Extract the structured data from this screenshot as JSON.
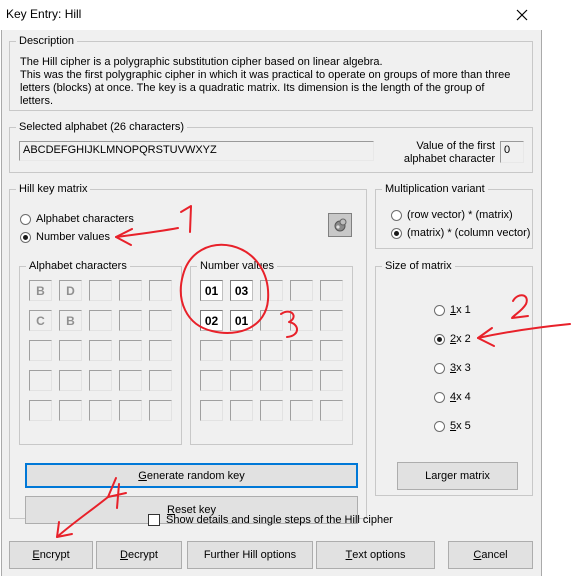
{
  "window": {
    "title": "Key Entry: Hill"
  },
  "description": {
    "legend": "Description",
    "lines": [
      "The Hill cipher is a polygraphic substitution cipher based on linear algebra.",
      "This was the first polygraphic cipher in which it was practical to operate on groups of more than three",
      "letters (blocks) at once. The key is a quadratic matrix. Its dimension is the length of the group of letters."
    ]
  },
  "alphabet": {
    "legend": "Selected alphabet (26 characters)",
    "value": "ABCDEFGHIJKLMNOPQRSTUVWXYZ",
    "first_value_label_1": "Value of the first",
    "first_value_label_2": "alphabet character",
    "first_value": "0"
  },
  "hill_key_matrix": {
    "legend": "Hill key matrix",
    "option_alphabet": "Alphabet characters",
    "option_numbers": "Number values",
    "selected": "Number values",
    "alpha_group_legend": "Alphabet characters",
    "number_group_legend": "Number values",
    "alpha_cells": [
      [
        "B",
        "D"
      ],
      [
        "C",
        "B"
      ]
    ],
    "number_cells": [
      [
        "01",
        "03"
      ],
      [
        "02",
        "01"
      ]
    ]
  },
  "multiplication": {
    "legend": "Multiplication variant",
    "option_1": "(row vector) * (matrix)",
    "option_2": "(matrix) * (column vector)",
    "selected": "(matrix) * (column vector)"
  },
  "size": {
    "legend": "Size of matrix",
    "options": [
      {
        "a": "1",
        "b": " x 1"
      },
      {
        "a": "2",
        "b": " x 2"
      },
      {
        "a": "3",
        "b": " x 3"
      },
      {
        "a": "4",
        "b": " x 4"
      },
      {
        "a": "5",
        "b": " x 5"
      }
    ],
    "selected": "2 x 2",
    "larger_button": "Larger matrix"
  },
  "buttons": {
    "generate_a": "G",
    "generate_b": "enerate random key",
    "reset_a": "R",
    "reset_b": "eset key",
    "encrypt_a": "E",
    "encrypt_b": "ncrypt",
    "decrypt_a": "D",
    "decrypt_b": "ecrypt",
    "further": "Further Hill options",
    "text_a": "T",
    "text_b": "ext options",
    "cancel_a": "C",
    "cancel_b": "ancel"
  },
  "show_details": {
    "label": "Show details and single steps of the Hill cipher",
    "checked": false
  },
  "annotations": [
    "1",
    "2",
    "3",
    "4"
  ],
  "colors": {
    "annotation": "#e8212a",
    "focus": "#0078d7"
  }
}
